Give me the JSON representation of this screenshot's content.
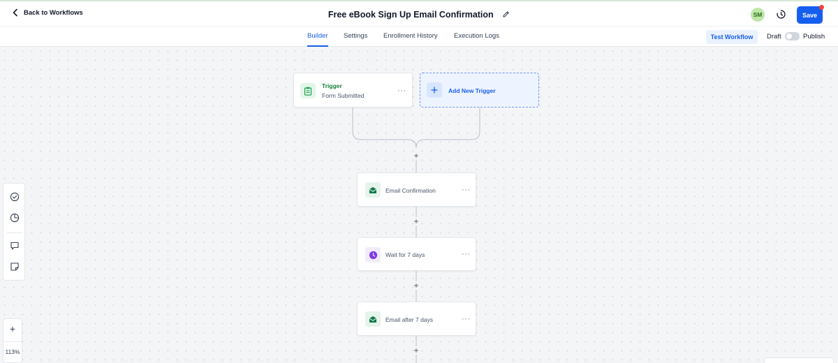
{
  "header": {
    "back_label": "Back to Workflows",
    "title": "Free eBook Sign Up Email Confirmation",
    "avatar_initials": "SM",
    "save_label": "Save"
  },
  "tabs": [
    {
      "label": "Builder",
      "active": true
    },
    {
      "label": "Settings",
      "active": false
    },
    {
      "label": "Enrollment History",
      "active": false
    },
    {
      "label": "Execution Logs",
      "active": false
    }
  ],
  "toolbar": {
    "test_label": "Test Workflow",
    "draft_label": "Draft",
    "publish_label": "Publish",
    "publish_on": false
  },
  "trigger": {
    "title": "Trigger",
    "subtitle": "Form Submitted",
    "icon": "clipboard-icon"
  },
  "add_trigger": {
    "label": "Add New Trigger"
  },
  "steps": [
    {
      "label": "Email Confirmation",
      "icon": "email-icon"
    },
    {
      "label": "Wait for 7 days",
      "icon": "clock-icon"
    },
    {
      "label": "Email after 7 days",
      "icon": "email-icon"
    }
  ],
  "zoom": {
    "level": "113%"
  },
  "colors": {
    "accent": "#155eef",
    "trigger_green": "#16a34a",
    "email_green": "#0f7b4a",
    "wait_purple": "#7c3aed"
  }
}
